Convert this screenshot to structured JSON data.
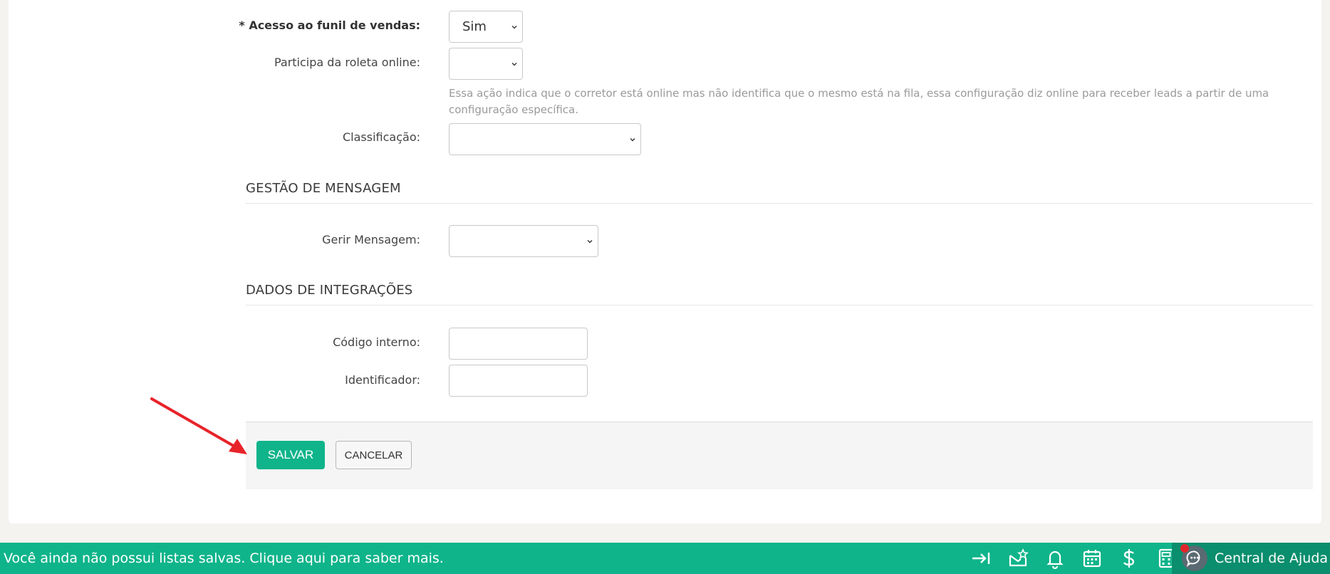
{
  "form": {
    "funnel_access": {
      "label": "* Acesso ao funil de vendas:",
      "value": "Sim"
    },
    "online_roulette": {
      "label": "Participa da roleta online:",
      "value": "",
      "help": "Essa ação indica que o corretor está online mas não identifica que o mesmo está na fila, essa configuração diz online para receber leads a partir de uma configuração específica."
    },
    "classification": {
      "label": "Classificação:",
      "value": ""
    }
  },
  "message_section": {
    "title": "GESTÃO DE MENSAGEM",
    "manage_label": "Gerir Mensagem:",
    "manage_value": ""
  },
  "integration_section": {
    "title": "DADOS DE INTEGRAÇÕES",
    "internal_code_label": "Código interno:",
    "internal_code_value": "",
    "identifier_label": "Identificador:",
    "identifier_value": ""
  },
  "actions": {
    "save_label": "SALVAR",
    "cancel_label": "CANCELAR"
  },
  "bottom_bar": {
    "message": "Você ainda não possui listas salvas. Clique aqui para saber mais.",
    "icons": [
      "collapse-icon",
      "mail-star-icon",
      "bell-icon",
      "calendar-icon",
      "dollar-icon",
      "calculator-icon"
    ],
    "help_center_label": "Central de Ajuda"
  },
  "colors": {
    "brand": "#0fb48a",
    "brand_dark": "#0a8e6d",
    "arrow": "#e8232a",
    "notification": "#e0262a"
  }
}
